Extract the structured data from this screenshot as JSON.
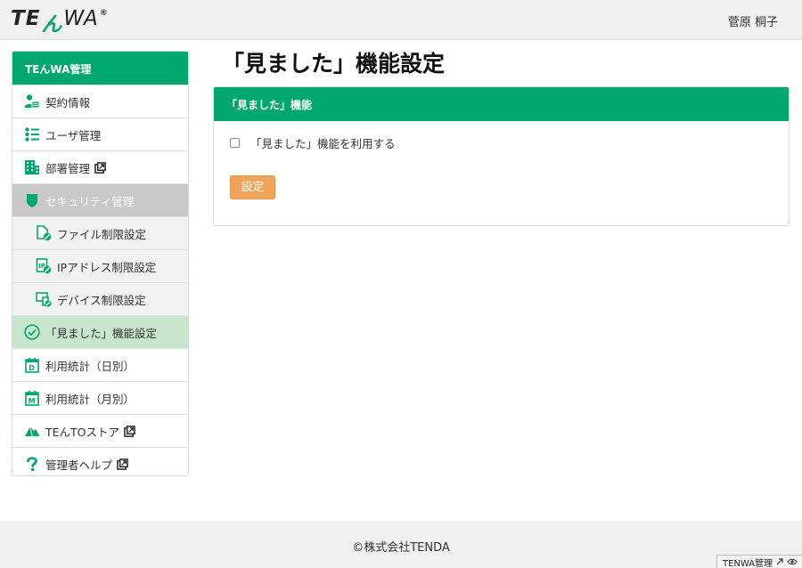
{
  "header": {
    "logo": {
      "part1": "TE",
      "part2": "ん",
      "part3": "WA",
      "mark": "®"
    },
    "username": "菅原 桐子"
  },
  "sidebar": {
    "heading": "TEんWA管理",
    "items": [
      {
        "label": "契約情報",
        "icon": "contract-user-icon"
      },
      {
        "label": "ユーザ管理",
        "icon": "users-list-icon"
      },
      {
        "label": "部署管理",
        "icon": "building-icon",
        "external": true
      },
      {
        "label": "セキュリティ管理",
        "icon": "shield-icon"
      },
      {
        "label": "ファイル制限設定",
        "icon": "file-restrict-icon"
      },
      {
        "label": "IPアドレス制限設定",
        "icon": "ip-restrict-icon"
      },
      {
        "label": "デバイス制限設定",
        "icon": "device-restrict-icon"
      },
      {
        "label": "「見ました」機能設定",
        "icon": "check-circle-icon"
      },
      {
        "label": "利用統計（日別）",
        "icon": "calendar-day-icon"
      },
      {
        "label": "利用統計（月別）",
        "icon": "calendar-month-icon"
      },
      {
        "label": "TEんTOストア",
        "icon": "cloud-store-icon",
        "external": true
      },
      {
        "label": "管理者ヘルプ",
        "icon": "question-icon",
        "external": true
      }
    ]
  },
  "main": {
    "title": "「見ました」機能設定",
    "panel": {
      "heading": "「見ました」機能",
      "checkbox_label": "「見ました」機能を利用する",
      "checkbox_checked": false,
      "button_label": "設定"
    }
  },
  "footer": {
    "copyright": "©株式会社TENDA",
    "corner_tab": "TENWA管理"
  },
  "colors": {
    "brand_green": "#00a870",
    "active_item": "#c8e6cc",
    "section_gray": "#c9c9c9",
    "button_orange": "#f0a35a"
  }
}
